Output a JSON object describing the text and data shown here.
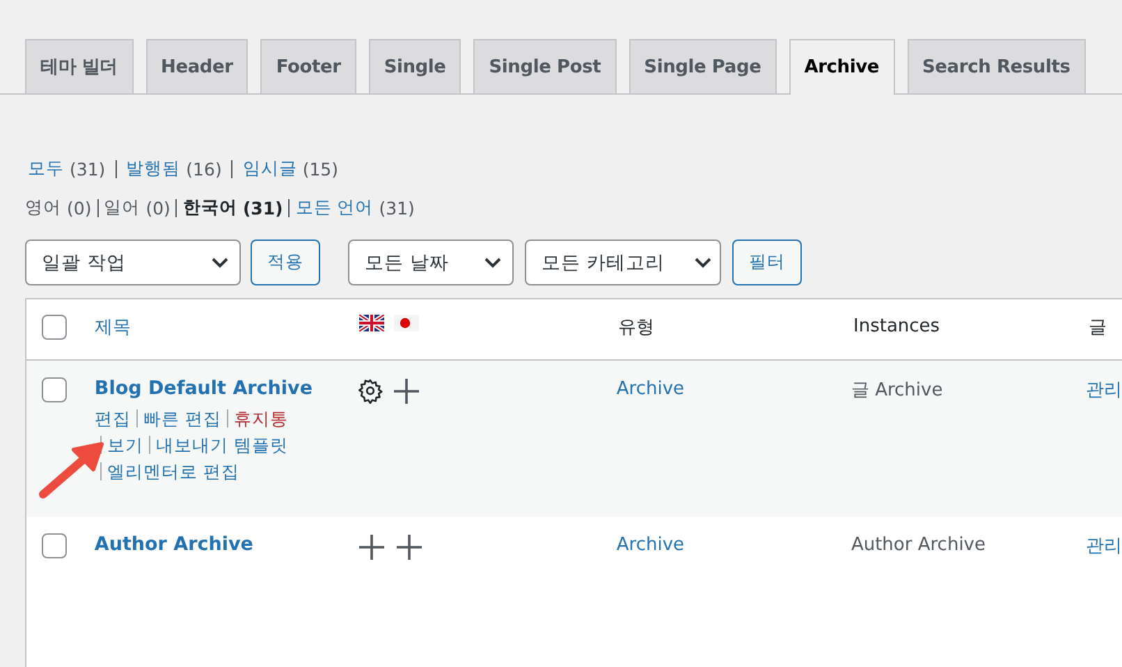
{
  "tabs": [
    {
      "label": "테마 빌더",
      "selected": false
    },
    {
      "label": "Header",
      "selected": false
    },
    {
      "label": "Footer",
      "selected": false
    },
    {
      "label": "Single",
      "selected": false
    },
    {
      "label": "Single Post",
      "selected": false
    },
    {
      "label": "Single Page",
      "selected": false
    },
    {
      "label": "Archive",
      "selected": true
    },
    {
      "label": "Search Results",
      "selected": false
    }
  ],
  "status_filter": [
    {
      "label": "모두",
      "count": "(31)",
      "current": false
    },
    {
      "label": "발행됨",
      "count": "(16)",
      "current": false
    },
    {
      "label": "임시글",
      "count": "(15)",
      "current": false
    }
  ],
  "language_filter": [
    {
      "label": "영어",
      "count": "(0)",
      "kind": "plain",
      "current": false
    },
    {
      "label": "일어",
      "count": "(0)",
      "kind": "plain",
      "current": false
    },
    {
      "label": "한국어",
      "count": "(31)",
      "kind": "plain",
      "current": true
    },
    {
      "label": "모든 언어",
      "count": "(31)",
      "kind": "link",
      "current": false
    }
  ],
  "toolbar": [
    {
      "kind": "select",
      "value": "일괄 작업"
    },
    {
      "kind": "button",
      "label": "적용"
    },
    {
      "kind": "select",
      "value": "모든 날짜"
    },
    {
      "kind": "select",
      "value": "모든 카테고리"
    },
    {
      "kind": "button",
      "label": "필터"
    }
  ],
  "table": {
    "select_all_checked": false,
    "columns": [
      "제목",
      "유형",
      "Instances",
      "글"
    ],
    "rows": [
      {
        "checked": false,
        "title": "Blog Default Archive",
        "translations": [
          {
            "kind": "settings"
          },
          {
            "kind": "add"
          }
        ],
        "type": "Archive",
        "instances": "글 Archive",
        "column_4": "관리",
        "row_actions": [
          [
            {
              "label": "편집",
              "kind": "link"
            },
            {
              "label": "빠른 편집",
              "kind": "link"
            },
            {
              "label": "휴지통",
              "kind": "trash"
            }
          ],
          [
            {
              "label": "보기",
              "kind": "link"
            },
            {
              "label": "내보내기 템플릿",
              "kind": "link"
            }
          ],
          [
            {
              "label": "엘리멘터로 편집",
              "kind": "link"
            }
          ]
        ]
      },
      {
        "checked": false,
        "title": "Author Archive",
        "translations": [
          {
            "kind": "add"
          },
          {
            "kind": "add"
          }
        ],
        "type": "Archive",
        "instances": "Author Archive",
        "column_4": "관리"
      }
    ]
  }
}
